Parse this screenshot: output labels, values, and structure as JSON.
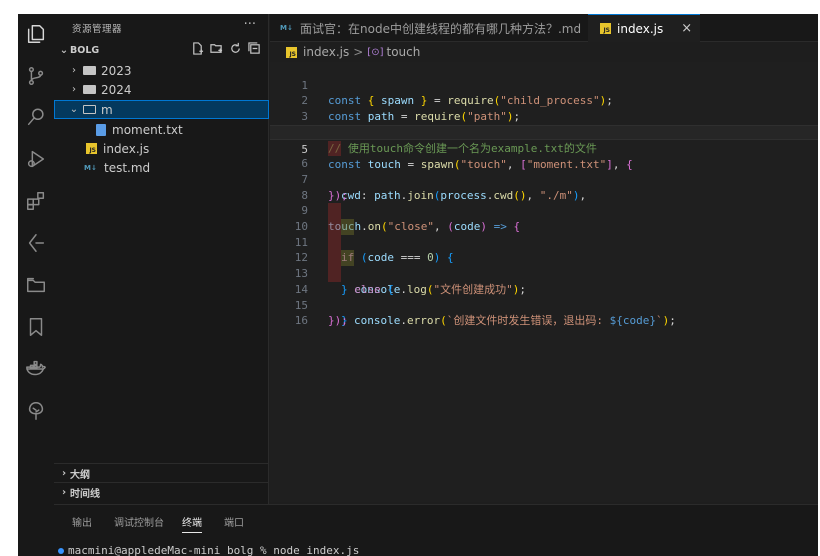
{
  "sidebar": {
    "title": "资源管理器",
    "more": "···",
    "project": "BOLG",
    "tree": [
      {
        "label": "2023",
        "kind": "folder"
      },
      {
        "label": "2024",
        "kind": "folder"
      },
      {
        "label": "m",
        "kind": "folder-open"
      },
      {
        "label": "moment.txt",
        "kind": "txt"
      },
      {
        "label": "index.js",
        "kind": "js"
      },
      {
        "label": "test.md",
        "kind": "md"
      }
    ],
    "outline": "大纲",
    "timeline": "时间线"
  },
  "tabs": [
    {
      "label": "面试官：在node中创建线程的都有哪几种方法？.md",
      "badge": "M↓"
    },
    {
      "label": "index.js",
      "badge": "JS",
      "close": "×"
    }
  ],
  "breadcrumb": {
    "file": "index.js",
    "separator": ">",
    "symbol_icon": "[⊙]",
    "symbol": "touch"
  },
  "editor": {
    "line_numbers": [
      "1",
      "2",
      "3",
      "4",
      "5",
      "6",
      "7",
      "8",
      "9",
      "10",
      "11",
      "12",
      "13",
      "14",
      "15",
      "16"
    ],
    "current_line": 5,
    "code": {
      "l1": {
        "kw": "const",
        "b1": "{",
        "v": "spawn",
        "b2": "}",
        "eq": "=",
        "fn": "require",
        "s": "\"child_process\"",
        "end": ";"
      },
      "l2": {
        "kw": "const",
        "v": "path",
        "eq": "=",
        "fn": "require",
        "s": "\"path\"",
        "end": ";"
      },
      "l4": {
        "comment": "// 使用touch命令创建一个名为example.txt的文件"
      },
      "l5": {
        "kw": "const",
        "v": "touch",
        "eq": "=",
        "fn": "spawn",
        "s1": "\"touch\"",
        "s2": "\"moment.txt\"",
        "tail": "{"
      },
      "l6": {
        "prop": "cwd",
        "obj": "path",
        "fn": "join",
        "obj2": "process",
        "fn2": "cwd",
        "s": "\"./m\"",
        "tail": ","
      },
      "l7": {
        "text": "});"
      },
      "l9": {
        "obj": "touch",
        "fn": "on",
        "s": "\"close\"",
        "param": "code",
        "arrow": "=>",
        "tail": "{"
      },
      "l10": {
        "kw": "if",
        "v": "code",
        "op": "===",
        "num": "0",
        "tail": "{"
      },
      "l11": {
        "obj": "console",
        "fn": "log",
        "s": "\"文件创建成功\"",
        "tail": ";"
      },
      "l12": {
        "b": "}",
        "kw": "else",
        "tail": "{"
      },
      "l13": {
        "obj": "console",
        "fn": "error",
        "s1": "`创建文件时发生错误，退出码: ",
        "tpl": "${code}",
        "s2": "`",
        "tail": ";"
      },
      "l14": {
        "text": "}"
      },
      "l15": {
        "text": "});"
      }
    }
  },
  "panel": {
    "tabs": [
      "输出",
      "调试控制台",
      "终端",
      "端口"
    ],
    "active_tab": "终端",
    "terminal": "macmini@appledeMac-mini bolg % node index.js"
  }
}
